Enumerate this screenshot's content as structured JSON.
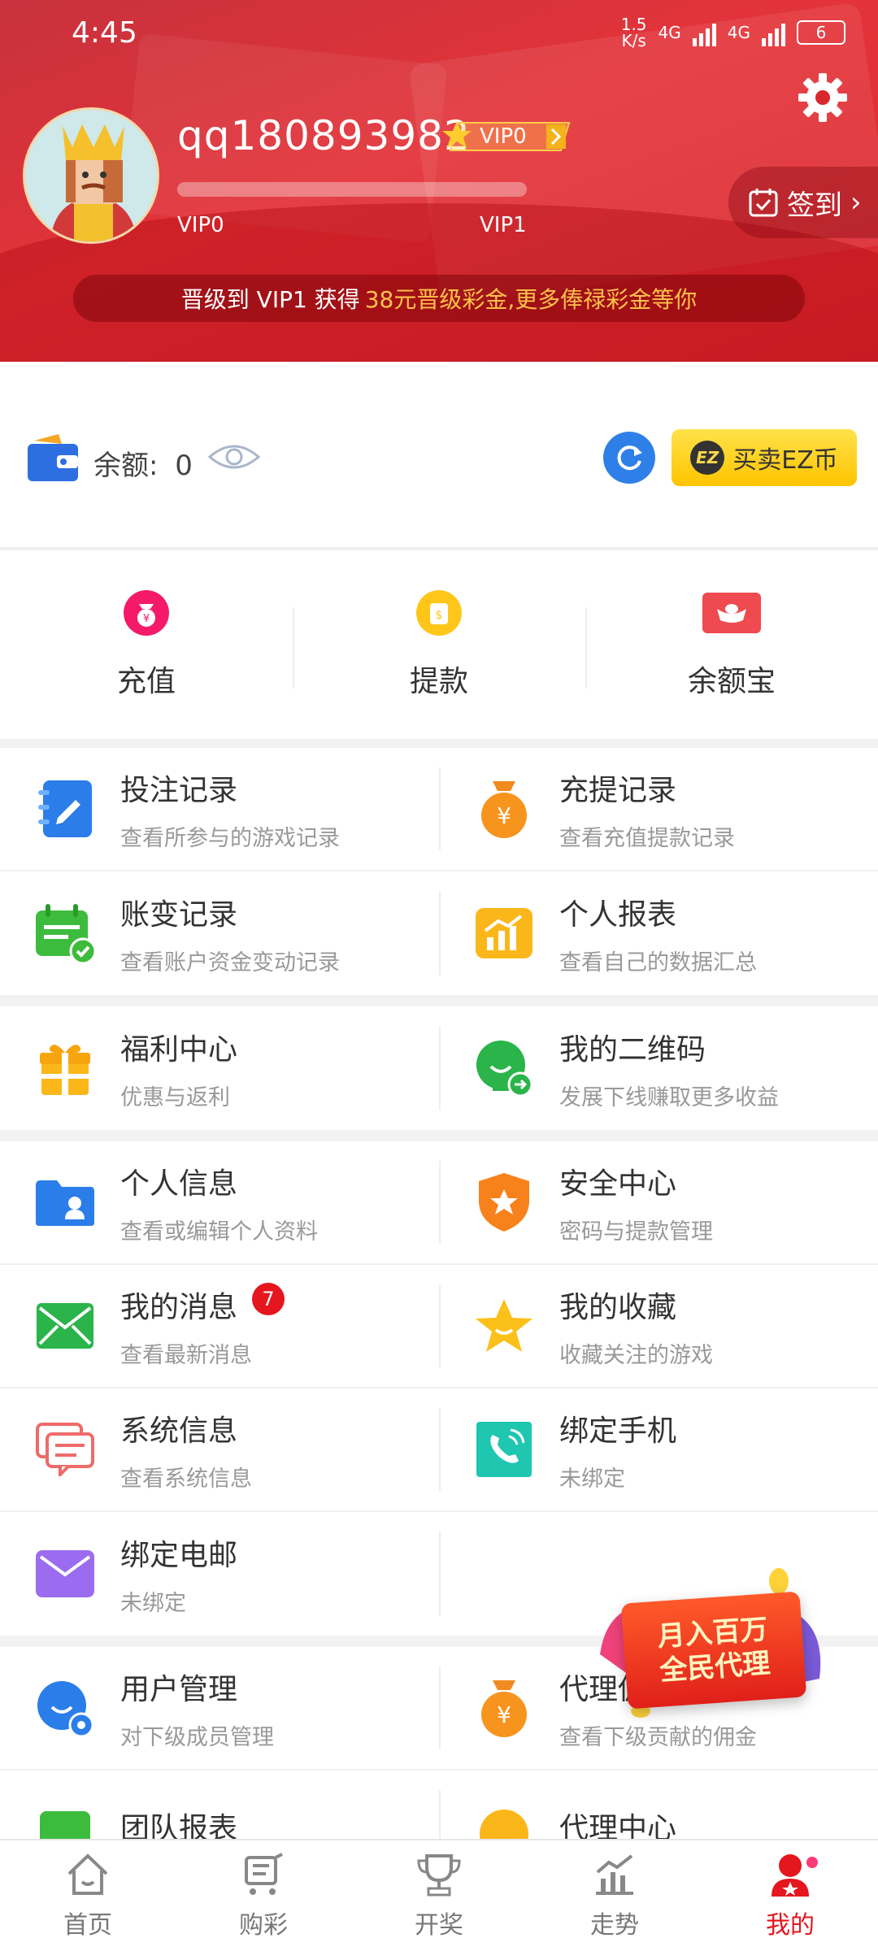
{
  "status_bar": {
    "time": "4:45",
    "speed_value": "1.5",
    "speed_unit": "K/s",
    "network_1": "4G",
    "network_2": "4G",
    "battery": "6"
  },
  "header": {
    "username": "qq180893982",
    "vip_badge": "VIP0",
    "level_current": "VIP0",
    "level_next": "VIP1",
    "progress": 0,
    "signin_label": "签到",
    "upgrade_prefix": "晋级到 VIP1 获得",
    "upgrade_highlight": "38元晋级彩金,更多俸禄彩金等你"
  },
  "balance": {
    "label": "余额:",
    "value": "0",
    "ez_label": "买卖EZ币",
    "ez_logo": "EZ"
  },
  "quick_actions": [
    {
      "label": "充值",
      "icon": "recharge-icon",
      "color": "#f5196a"
    },
    {
      "label": "提款",
      "icon": "withdraw-icon",
      "color": "#ffc61a"
    },
    {
      "label": "余额宝",
      "icon": "yuebao-icon",
      "color": "#ef4a4f"
    }
  ],
  "menu": [
    {
      "title": "投注记录",
      "sub": "查看所参与的游戏记录",
      "icon": "notebook-icon"
    },
    {
      "title": "充提记录",
      "sub": "查看充值提款记录",
      "icon": "money-bag-icon"
    },
    {
      "title": "账变记录",
      "sub": "查看账户资金变动记录",
      "icon": "calendar-check-icon"
    },
    {
      "title": "个人报表",
      "sub": "查看自己的数据汇总",
      "icon": "chart-icon"
    },
    {
      "title": "福利中心",
      "sub": "优惠与返利",
      "icon": "gift-icon"
    },
    {
      "title": "我的二维码",
      "sub": "发展下线赚取更多收益",
      "icon": "qr-share-icon"
    },
    {
      "title": "个人信息",
      "sub": "查看或编辑个人资料",
      "icon": "profile-folder-icon"
    },
    {
      "title": "安全中心",
      "sub": "密码与提款管理",
      "icon": "shield-icon"
    },
    {
      "title": "我的消息",
      "sub": "查看最新消息",
      "icon": "mail-icon",
      "badge": "7"
    },
    {
      "title": "我的收藏",
      "sub": "收藏关注的游戏",
      "icon": "star-icon"
    },
    {
      "title": "系统信息",
      "sub": "查看系统信息",
      "icon": "chat-bubbles-icon"
    },
    {
      "title": "绑定手机",
      "sub": "未绑定",
      "icon": "phone-icon"
    },
    {
      "title": "绑定电邮",
      "sub": "未绑定",
      "icon": "envelope-icon"
    },
    {
      "title": "用户管理",
      "sub": "对下级成员管理",
      "icon": "user-gear-icon"
    },
    {
      "title": "代理佣金",
      "sub": "查看下级贡献的佣金",
      "icon": "commission-bag-icon"
    },
    {
      "title": "团队报表",
      "sub": "",
      "icon": "team-report-icon"
    },
    {
      "title": "代理中心",
      "sub": "",
      "icon": "agent-center-icon"
    }
  ],
  "promo": {
    "line1": "月入百万",
    "line2": "全民代理"
  },
  "bottom_nav": [
    {
      "label": "首页",
      "icon": "home-icon"
    },
    {
      "label": "购彩",
      "icon": "cart-icon"
    },
    {
      "label": "开奖",
      "icon": "trophy-icon"
    },
    {
      "label": "走势",
      "icon": "trend-icon"
    },
    {
      "label": "我的",
      "icon": "user-icon",
      "active": true
    }
  ],
  "colors": {
    "brand_red": "#e4333a",
    "gold": "#ffc24a",
    "active_tab": "#e5161e"
  }
}
